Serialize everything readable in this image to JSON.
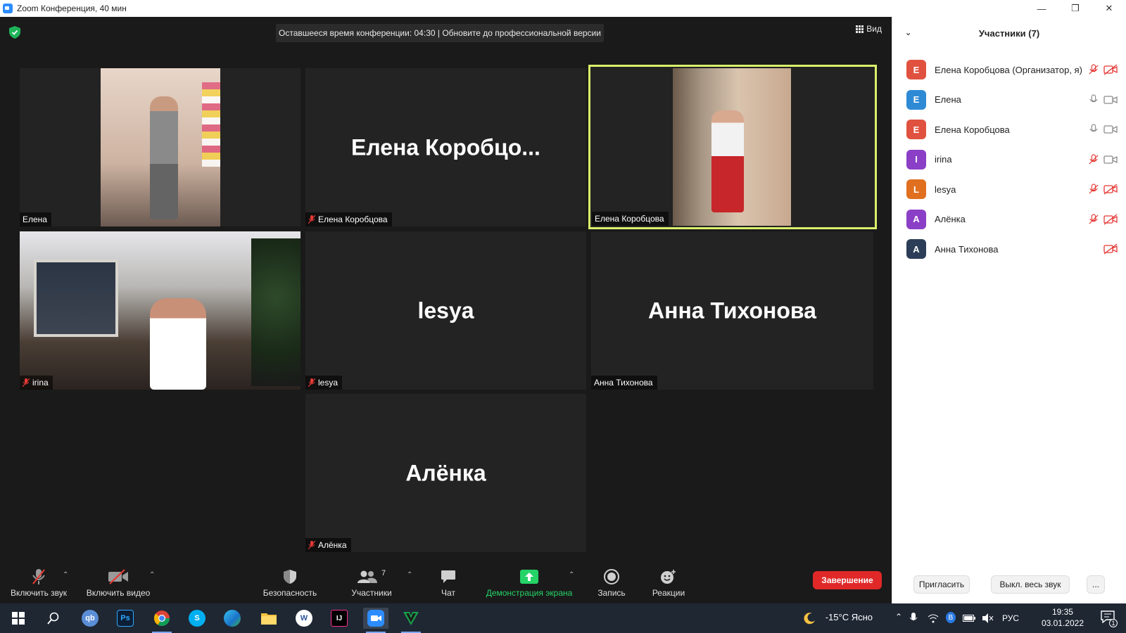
{
  "window": {
    "title": "Zoom Конференция, 40 мин",
    "controls": [
      "minimize",
      "restore",
      "close"
    ]
  },
  "meeting": {
    "banner": "Оставшееся время конференции: 04:30 | Обновите до профессиональной версии",
    "view_label": "Вид",
    "accent_color": "#d9f26b",
    "tiles": [
      {
        "id": "elena",
        "label": "Елена",
        "big_name": "",
        "video": true,
        "muted": false
      },
      {
        "id": "korobtsova-1",
        "label": "Елена Коробцова",
        "big_name": "Елена  Коробцо...",
        "video": false,
        "muted": true
      },
      {
        "id": "korobtsova-2",
        "label": "Елена Коробцова",
        "big_name": "",
        "video": true,
        "muted": false,
        "active_speaker": true
      },
      {
        "id": "irina",
        "label": "irina",
        "big_name": "",
        "video": true,
        "muted": true
      },
      {
        "id": "lesya",
        "label": "lesya",
        "big_name": "lesya",
        "video": false,
        "muted": true
      },
      {
        "id": "anna",
        "label": "Анна Тихонова",
        "big_name": "Анна Тихонова",
        "video": false,
        "muted": false
      },
      {
        "id": "alenka",
        "label": "Алёнка",
        "big_name": "Алёнка",
        "video": false,
        "muted": true
      }
    ]
  },
  "toolbar": {
    "unmute_label": "Включить звук",
    "start_video_label": "Включить видео",
    "security_label": "Безопасность",
    "participants_label": "Участники",
    "participants_count": "7",
    "chat_label": "Чат",
    "share_label": "Демонстрация экрана",
    "record_label": "Запись",
    "reactions_label": "Реакции",
    "end_label": "Завершение",
    "end_color": "#e02828",
    "share_color": "#25d366"
  },
  "participants_panel": {
    "title": "Участники (7)",
    "items": [
      {
        "initial": "Е",
        "name": "Елена Коробцова (Организатор, я)",
        "color": "#e0523f",
        "mic": "muted",
        "camera": "off"
      },
      {
        "initial": "Е",
        "name": "Елена",
        "color": "#2f8ad6",
        "mic": "on",
        "camera": "on"
      },
      {
        "initial": "Е",
        "name": "Елена Коробцова",
        "color": "#e0523f",
        "mic": "on",
        "camera": "on"
      },
      {
        "initial": "I",
        "name": "irina",
        "color": "#8b3fc6",
        "mic": "muted",
        "camera": "on"
      },
      {
        "initial": "L",
        "name": "lesya",
        "color": "#e06f1f",
        "mic": "muted",
        "camera": "off"
      },
      {
        "initial": "А",
        "name": "Алёнка",
        "color": "#8b3fc6",
        "mic": "muted",
        "camera": "off"
      },
      {
        "initial": "А",
        "name": "Анна Тихонова",
        "color": "#2c3e57",
        "mic": "none",
        "camera": "off"
      }
    ],
    "invite_label": "Пригласить",
    "mute_all_label": "Выкл. весь звук",
    "more_label": "..."
  },
  "taskbar": {
    "apps": [
      "windows-start",
      "search",
      "qbittorrent",
      "photoshop",
      "chrome",
      "skype",
      "edge",
      "file-explorer",
      "word",
      "intellij",
      "zoom",
      "vim"
    ],
    "weather": "-15°C  Ясно",
    "language": "РУС",
    "time": "19:35",
    "date": "03.01.2022",
    "notifications": "1"
  }
}
